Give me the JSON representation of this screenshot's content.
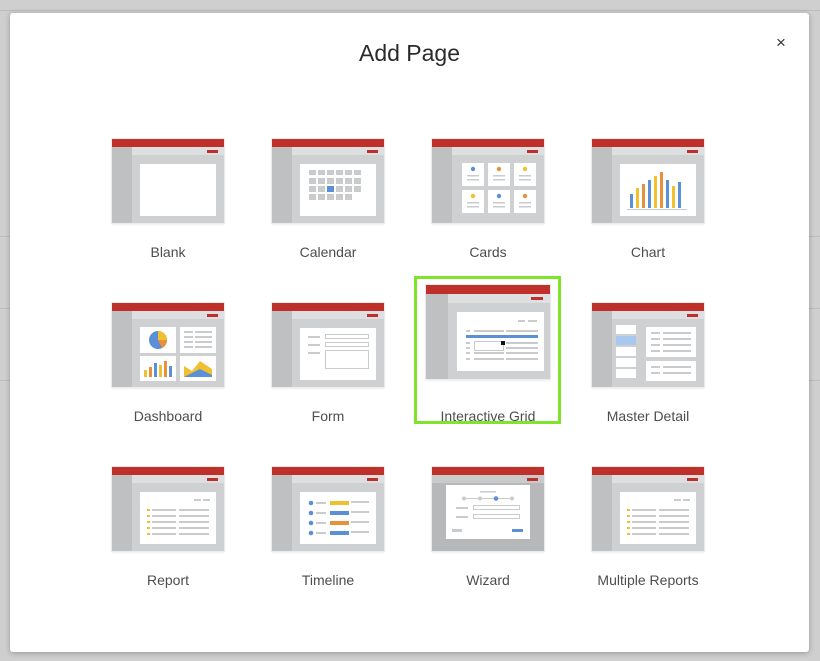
{
  "dialog": {
    "title": "Add Page",
    "close_icon": "close-icon",
    "close_glyph": "×",
    "selected_tile": "Interactive Grid",
    "selection_color": "#7fe52b",
    "accent_color": "#c0302a"
  },
  "tiles": [
    {
      "label": "Blank",
      "icon": "blank-page-icon"
    },
    {
      "label": "Calendar",
      "icon": "calendar-page-icon"
    },
    {
      "label": "Cards",
      "icon": "cards-page-icon"
    },
    {
      "label": "Chart",
      "icon": "chart-page-icon"
    },
    {
      "label": "Dashboard",
      "icon": "dashboard-page-icon"
    },
    {
      "label": "Form",
      "icon": "form-page-icon"
    },
    {
      "label": "Interactive Grid",
      "icon": "interactive-grid-page-icon"
    },
    {
      "label": "Master Detail",
      "icon": "master-detail-page-icon"
    },
    {
      "label": "Report",
      "icon": "report-page-icon"
    },
    {
      "label": "Timeline",
      "icon": "timeline-page-icon"
    },
    {
      "label": "Wizard",
      "icon": "wizard-page-icon"
    },
    {
      "label": "Multiple Reports",
      "icon": "multiple-reports-page-icon"
    }
  ]
}
